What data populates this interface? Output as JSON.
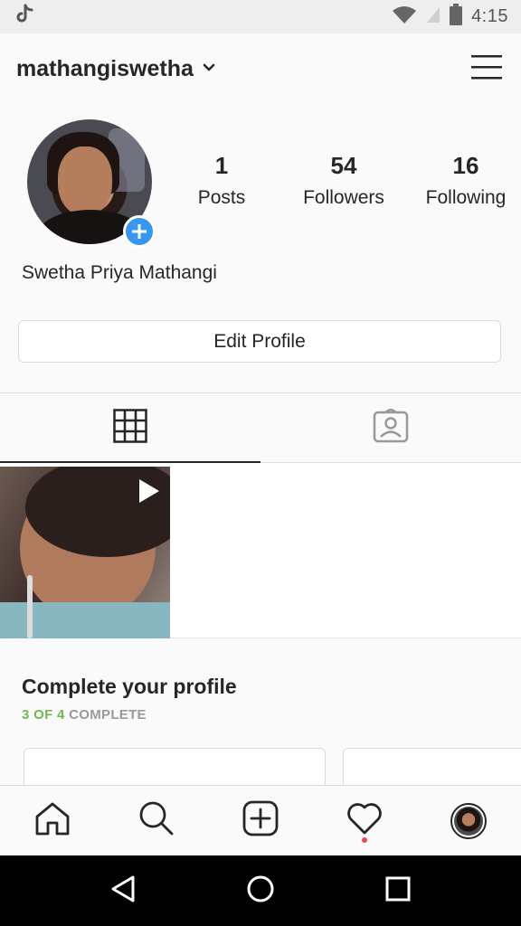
{
  "status_bar": {
    "time": "4:15",
    "app_icon": "tiktok-icon",
    "wifi_icon": "wifi-icon",
    "signal_icon": "signal-icon",
    "battery_icon": "battery-icon"
  },
  "header": {
    "username": "mathangiswetha",
    "dropdown_icon": "chevron-down-icon",
    "menu_icon": "hamburger-menu-icon"
  },
  "profile": {
    "full_name": "Swetha Priya Mathangi",
    "add_story_icon": "plus-icon",
    "stats": [
      {
        "value": "1",
        "label": "Posts"
      },
      {
        "value": "54",
        "label": "Followers"
      },
      {
        "value": "16",
        "label": "Following"
      }
    ],
    "edit_button": "Edit Profile"
  },
  "tabs": [
    {
      "icon": "grid-icon",
      "active": true
    },
    {
      "icon": "tagged-person-icon",
      "active": false
    }
  ],
  "posts": [
    {
      "type": "video",
      "icon": "play-icon"
    }
  ],
  "complete_profile": {
    "title": "Complete your profile",
    "progress_done": "3 OF 4",
    "progress_rest": "COMPLETE",
    "progress_color": "#6dbb4d"
  },
  "bottom_nav": [
    {
      "icon": "home-icon"
    },
    {
      "icon": "search-icon"
    },
    {
      "icon": "add-post-icon"
    },
    {
      "icon": "heart-icon",
      "notification": true
    },
    {
      "icon": "profile-avatar-icon"
    }
  ],
  "android_nav": [
    {
      "icon": "back-icon"
    },
    {
      "icon": "home-circle-icon"
    },
    {
      "icon": "recents-icon"
    }
  ],
  "colors": {
    "accent_blue": "#3897f0",
    "notification_red": "#ed4956",
    "text_primary": "#262626"
  }
}
